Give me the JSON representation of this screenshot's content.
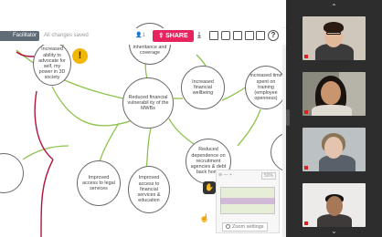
{
  "toolbar": {
    "role_label": "Facilitator",
    "save_status": "All changes saved",
    "user_count": "1",
    "share_label": "SHARE",
    "help": "?"
  },
  "nodes": {
    "increased_ability": "Increased ability to advocate for self, my power in 3D society",
    "inheritance": "inheritance and coverage",
    "reduced_vulnerability": "Reduced financial vulnerabil ity of the MWBs",
    "increased_wellbeing": "Increased financial wellbeing",
    "increased_time": "Increased time spent on training (employee openness)",
    "improved_legal": "Improved access to legal services",
    "improved_financial": "Improved access to financial services & education",
    "reduced_dependence": "Reduced dependence on recruitment agencies & debt back home"
  },
  "warning_icon": "!",
  "minimap": {
    "zoom_value": "50%",
    "zoom_settings": "Zoom settings"
  },
  "video_panel": {
    "up_arrow": "⌃",
    "down_arrow": "⌄"
  },
  "colors": {
    "share": "#e8245f",
    "edge_green": "#8cc34b",
    "edge_red": "#b3123c",
    "warning": "#f2b705",
    "video_bg": "#2d2d2d"
  }
}
